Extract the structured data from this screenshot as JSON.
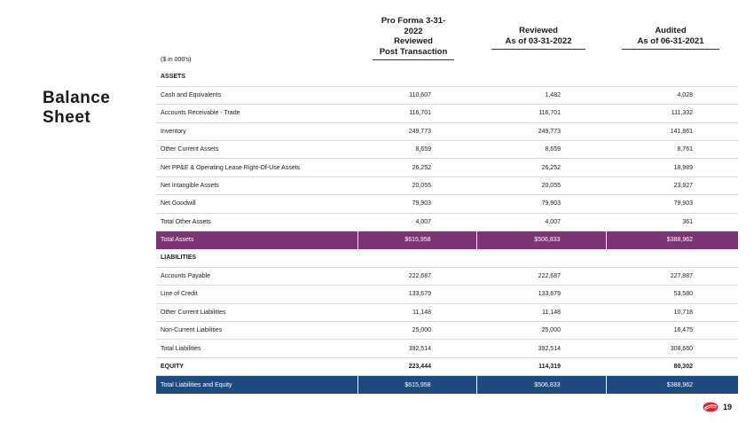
{
  "title": "Balance\nSheet",
  "units": "($ in 000's)",
  "columns": [
    {
      "line1": "Pro Forma 3-31-2022",
      "line2": "Reviewed",
      "line3": "Post Transaction"
    },
    {
      "line1": "Reviewed",
      "line2": "As of 03-31-2022"
    },
    {
      "line1": "Audited",
      "line2": "As of 06-31-2021"
    }
  ],
  "rows": [
    {
      "label": "ASSETS",
      "values": [
        "",
        "",
        ""
      ],
      "style": "section"
    },
    {
      "label": "Cash and Equivalents",
      "values": [
        "110,607",
        "1,482",
        "4,028"
      ]
    },
    {
      "label": "Accounts Receivable - Trade",
      "values": [
        "116,701",
        "116,701",
        "111,332"
      ]
    },
    {
      "label": "Inventory",
      "values": [
        "249,773",
        "249,773",
        "141,861"
      ]
    },
    {
      "label": "Other Current Assets",
      "values": [
        "8,659",
        "8,659",
        "8,761"
      ]
    },
    {
      "label": "Net PP&E & Operating Lease Right-Of-Use Assets",
      "values": [
        "26,252",
        "26,252",
        "18,989"
      ]
    },
    {
      "label": "Net Intangible Assets",
      "values": [
        "20,055",
        "20,055",
        "23,927"
      ]
    },
    {
      "label": "Net Goodwill",
      "values": [
        "79,903",
        "79,903",
        "79,903"
      ]
    },
    {
      "label": "Total Other Assets",
      "values": [
        "4,007",
        "4,007",
        "361"
      ]
    },
    {
      "label": "Total Assets",
      "values": [
        "$615,958",
        "$506,833",
        "$388,962"
      ],
      "style": "total-purple"
    },
    {
      "label": "LIABILITIES",
      "values": [
        "",
        "",
        ""
      ],
      "style": "section"
    },
    {
      "label": "Accounts Payable",
      "values": [
        "222,687",
        "222,687",
        "227,887"
      ]
    },
    {
      "label": "Line of Credit",
      "values": [
        "133,679",
        "133,679",
        "53,580"
      ]
    },
    {
      "label": "Other Current Liabilities",
      "values": [
        "11,148",
        "11,148",
        "10,718"
      ]
    },
    {
      "label": "Non-Current Liabilities",
      "values": [
        "25,000",
        "25,000",
        "16,475"
      ]
    },
    {
      "label": "Total Liabilities",
      "values": [
        "392,514",
        "392,514",
        "308,660"
      ],
      "style": "total-liab"
    },
    {
      "label": "EQUITY",
      "values": [
        "223,444",
        "114,319",
        "80,302"
      ],
      "style": "section"
    },
    {
      "label": "Total Liabilities and Equity",
      "values": [
        "$615,958",
        "$506,833",
        "$388,962"
      ],
      "style": "total-blue"
    }
  ],
  "page_number": "19",
  "colors": {
    "total_assets_bg": "#7b3572",
    "total_le_bg": "#1e4a7e",
    "logo": "#e0262d"
  },
  "icons": {
    "logo": "company-logo-icon"
  }
}
